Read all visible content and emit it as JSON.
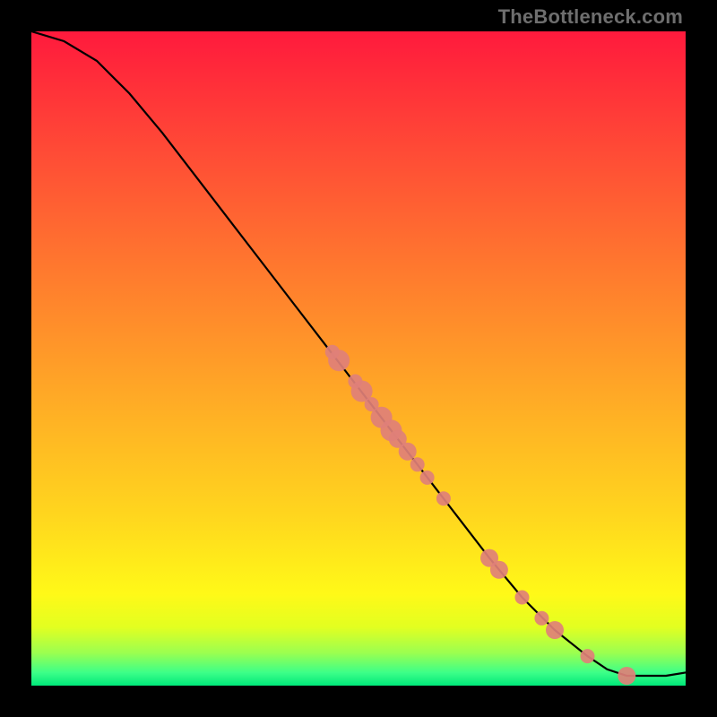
{
  "watermark": "TheBottleneck.com",
  "chart_data": {
    "type": "line",
    "title": "",
    "xlabel": "",
    "ylabel": "",
    "xlim": [
      0,
      100
    ],
    "ylim": [
      0,
      100
    ],
    "series": [
      {
        "name": "curve",
        "x": [
          0,
          5,
          10,
          15,
          20,
          25,
          30,
          35,
          40,
          45,
          50,
          55,
          60,
          65,
          70,
          75,
          80,
          85,
          88,
          91,
          97,
          100
        ],
        "y": [
          100,
          98.5,
          95.5,
          90.5,
          84.5,
          78,
          71.5,
          65,
          58.5,
          52,
          45.5,
          39,
          32.5,
          26,
          19.5,
          13.5,
          8.5,
          4.5,
          2.5,
          1.5,
          1.5,
          2.0
        ]
      }
    ],
    "markers": {
      "name": "highlighted-points",
      "color": "#e08078",
      "points": [
        {
          "x": 46.0,
          "y": 51.0,
          "r": 8
        },
        {
          "x": 47.0,
          "y": 49.7,
          "r": 12
        },
        {
          "x": 49.5,
          "y": 46.5,
          "r": 8
        },
        {
          "x": 50.5,
          "y": 45.0,
          "r": 12
        },
        {
          "x": 52.0,
          "y": 43.0,
          "r": 8
        },
        {
          "x": 53.5,
          "y": 41.0,
          "r": 12
        },
        {
          "x": 55.0,
          "y": 39.0,
          "r": 12
        },
        {
          "x": 56.0,
          "y": 37.7,
          "r": 10
        },
        {
          "x": 57.5,
          "y": 35.8,
          "r": 10
        },
        {
          "x": 59.0,
          "y": 33.8,
          "r": 8
        },
        {
          "x": 60.5,
          "y": 31.8,
          "r": 8
        },
        {
          "x": 63.0,
          "y": 28.6,
          "r": 8
        },
        {
          "x": 70.0,
          "y": 19.5,
          "r": 10
        },
        {
          "x": 71.5,
          "y": 17.7,
          "r": 10
        },
        {
          "x": 75.0,
          "y": 13.5,
          "r": 8
        },
        {
          "x": 78.0,
          "y": 10.3,
          "r": 8
        },
        {
          "x": 80.0,
          "y": 8.5,
          "r": 10
        },
        {
          "x": 85.0,
          "y": 4.5,
          "r": 8
        },
        {
          "x": 91.0,
          "y": 1.5,
          "r": 10
        }
      ]
    }
  }
}
